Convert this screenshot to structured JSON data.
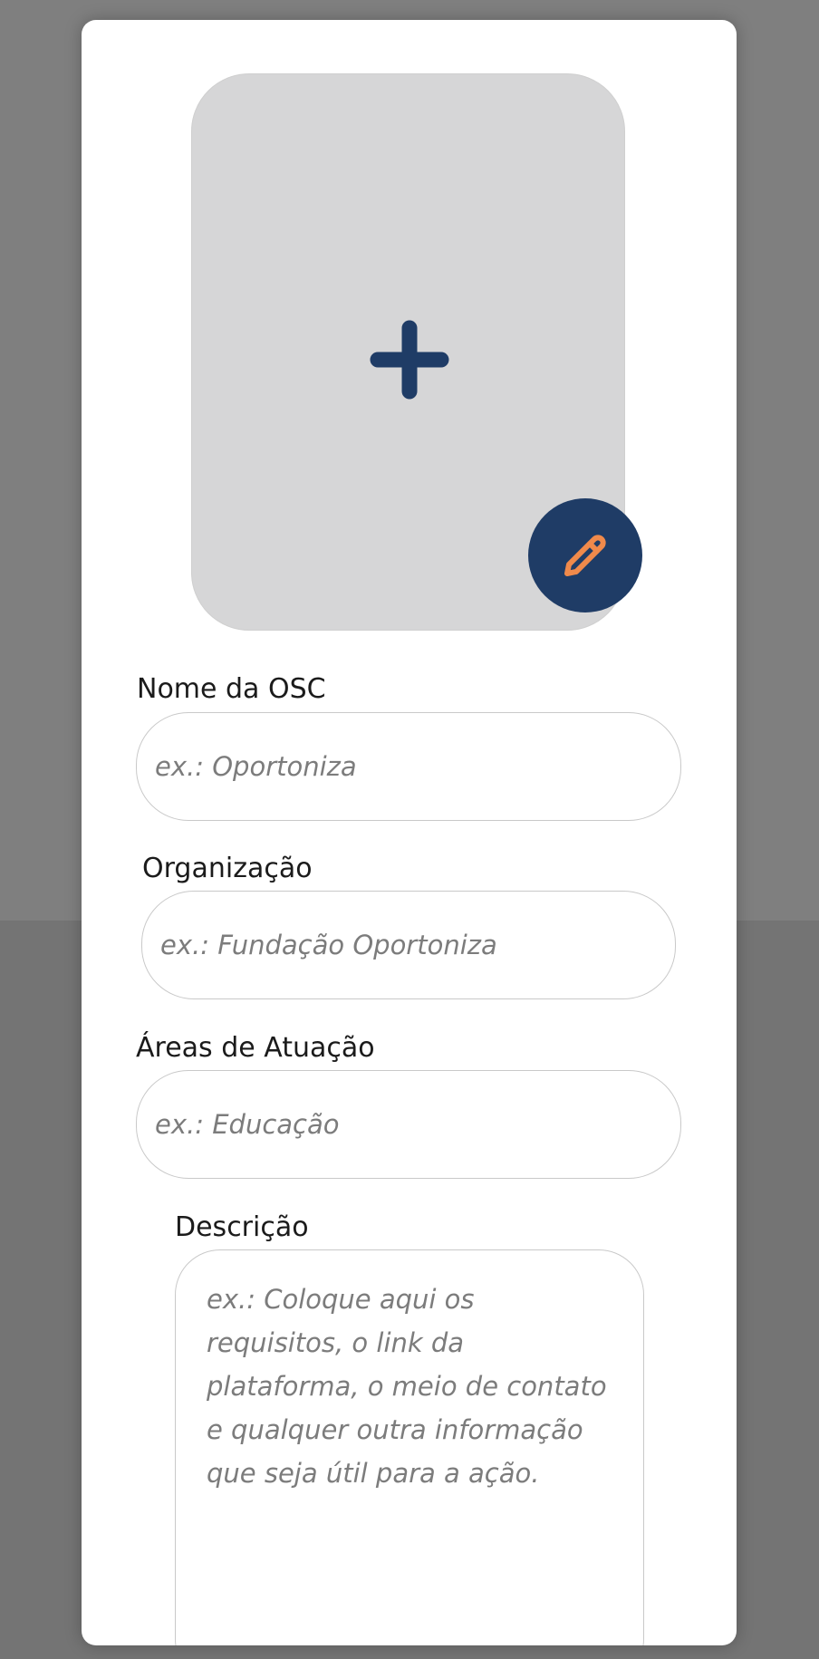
{
  "colors": {
    "accent_navy": "#1f3c66",
    "accent_orange": "#f08a4b",
    "image_placeholder_bg": "#d6d6d7"
  },
  "image_picker": {
    "add_icon": "plus-icon",
    "edit_icon": "pencil-icon"
  },
  "form": {
    "name": {
      "label": "Nome da OSC",
      "placeholder": "ex.: Oportoniza",
      "value": ""
    },
    "organization": {
      "label": "Organização",
      "placeholder": "ex.: Fundação Oportoniza",
      "value": ""
    },
    "areas": {
      "label": "Áreas de Atuação",
      "placeholder": "ex.: Educação",
      "value": ""
    },
    "description": {
      "label": "Descrição",
      "placeholder": "ex.: Coloque aqui os requisitos, o link da plataforma, o meio de contato e qualquer outra informação que seja útil para a ação.",
      "value": ""
    }
  }
}
